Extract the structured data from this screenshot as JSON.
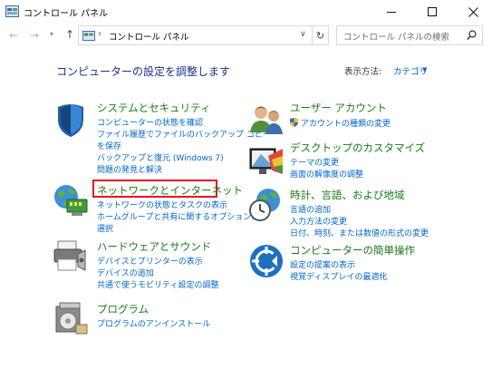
{
  "window": {
    "title": "コントロール パネル"
  },
  "address_bar": {
    "path": "コントロール パネル",
    "search_placeholder": "コントロール パネルの検索"
  },
  "header": {
    "title": "コンピューターの設定を調整します",
    "view_by_label": "表示方法:",
    "view_by_value": "カテゴリ"
  },
  "categories": [
    {
      "title": "システムとセキュリティ",
      "links": [
        "コンピューターの状態を確認",
        "ファイル履歴でファイルのバックアップ コピー",
        "を保存",
        "バックアップと復元 (Windows 7)",
        "問題の発見と解決"
      ]
    },
    {
      "title": "ネットワークとインターネット",
      "links": [
        "ネットワークの状態とタスクの表示",
        "ホームグループと共有に関するオプションの",
        "選択"
      ]
    },
    {
      "title": "ハードウェアとサウンド",
      "links": [
        "デバイスとプリンターの表示",
        "デバイスの追加",
        "共通で使うモビリティ設定の調整"
      ]
    },
    {
      "title": "プログラム",
      "links": [
        "プログラムのアンインストール"
      ]
    },
    {
      "title": "ユーザー アカウント",
      "links": [
        "アカウントの種類の変更"
      ]
    },
    {
      "title": "デスクトップのカスタマイズ",
      "links": [
        "テーマの変更",
        "画面の解像度の調整"
      ]
    },
    {
      "title": "時計、言語、および地域",
      "links": [
        "言語の追加",
        "入力方法の変更",
        "日付、時刻、または数値の形式の変更"
      ]
    },
    {
      "title": "コンピューターの簡単操作",
      "links": [
        "設定の提案の表示",
        "視覚ディスプレイの最適化"
      ]
    }
  ],
  "colors": {
    "category_title": "#1b7a1b",
    "link": "#0066cc",
    "heading": "#1e3287",
    "highlight": "#e81123"
  }
}
